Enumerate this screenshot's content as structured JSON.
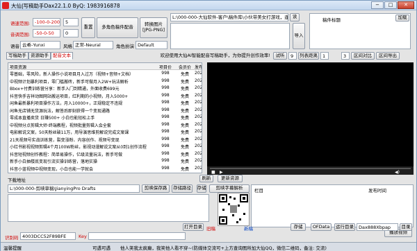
{
  "window": {
    "title": "大仙|写稿助手Dax22.1.0 ByQ: 1983916878",
    "min": "−",
    "max": "□",
    "close": "✕"
  },
  "top": {
    "speed_label": "语速范围:",
    "speed_range": "-100-0-200",
    "speed_value": "5",
    "volume_label": "音调范围:",
    "volume_range": "-50-0-50",
    "volume_value": "0",
    "reset_btn": "重置",
    "multi_role_btn": "多角色稿件配音",
    "convert_btn": "转换图片 [JPG-PNG]",
    "voice_label": "语音",
    "voice_value": "云希-Yunxi",
    "style_label": "风格",
    "style_value": "正常-Neural",
    "role_label": "角色扮演",
    "role_value": "Default",
    "path_value": "L:\\000-000-大仙软件-客户\\稿件库\\小伙带美女打游戏，逢料",
    "read_btn": "读",
    "import_btn": "导入",
    "script_title_label": "稿件标题",
    "load_btn": "加载"
  },
  "tabs": {
    "writing": "写稿助手",
    "resources": "资源助手",
    "dubbing": "配音文本"
  },
  "welcome": "欢迎使用大仙AI智能配音写稿助手，为你提升创作效率!",
  "player": {
    "listen_btn": "试听",
    "count1": "9",
    "dist_btn": "列表距离",
    "count2": "1",
    "check_btn": "区间对比",
    "num": "3",
    "section_btn": "区间对比",
    "export_btn": "区间导出"
  },
  "grid": {
    "headers": [
      "项目资源",
      "项目价",
      "会员价",
      "发布时间"
    ],
    "rows": [
      [
        "零基础，零风险，新人操作小说项目月入过万（视频+音频+文档）",
        "998",
        "免费",
        "2022-06-11"
      ],
      [
        "中视频计划暴利项目，零门槛搬砖，新手可做月入2W+玩法解析",
        "998",
        "免费",
        "2022-06-11"
      ],
      [
        "Bbox+付费训练营分享：新手入门到精通，外面收费699元",
        "998",
        "免费",
        "2022-06-11"
      ],
      [
        "抖音快手吉祥动图网站搬运项目，红利期的小视频，月入5000+",
        "998",
        "免费",
        "2022-06-11"
      ],
      [
        "闲鱼最新暴利项目操作方法，月入10000+，正规稳定不违规",
        "998",
        "免费",
        "2022-06-11"
      ],
      [
        "闲鱼无店铺无货源玩法，解答后即刻获得一个变现通路",
        "998",
        "免费",
        "2022-06-11"
      ],
      [
        "零成本直播卖货 日赚500+ 小白也能轻松上手",
        "998",
        "免费",
        "2022-06-11"
      ],
      [
        "中视频分点剪辑大师·终端教程，视频批量剪辑入会全套",
        "998",
        "免费",
        "2022-06-11"
      ],
      [
        "电影解说文案，50天粉丝破11万，用导演思维剪解说完成文案课",
        "998",
        "免费",
        "2022-06-11"
      ],
      [
        "21天视频号实战训练营，裂变涨粉、内容创作、视频号变现",
        "998",
        "免费",
        "2022-06-11"
      ],
      [
        "小红书影视视频剪辑4个月100W粉丝，影视动漫解说文案从0到1创作流程",
        "998",
        "免费",
        "2022-06-11"
      ],
      [
        "抖音短视频创作教程：简单易操作，亿级流量玩法，新手可做",
        "998",
        "免费",
        "2022-06-11"
      ],
      [
        "新手小白抽楼底变现引流实操训练营，落地实操",
        "998",
        "免费",
        "2022-06-11"
      ],
      [
        "抖音小蓝视频中视频变现，小白也能一学就会",
        "998",
        "免费",
        "2022-06-11"
      ]
    ]
  },
  "download": {
    "label": "下载地址",
    "refresh_btn": "刷新",
    "update_btn": "更新资源",
    "path": "L:\\000-000-剪映草稿\\JianyingPro Drafts",
    "save_btn": "剪映保存路",
    "save_path_btn": "存储路径",
    "parse_btn": "剪映字幕解析",
    "save2_btn": "存储",
    "column_label": "栏目",
    "time_label": "发布时间",
    "play_btn": "播放视频"
  },
  "bottom": {
    "open_dir_btn": "打开目录",
    "old_label": "旧稿",
    "new_label": "新稿",
    "store_btn": "存储",
    "data_btn": "OFData",
    "run_btn": "运行目录",
    "run_value": "Dax888Xbpap",
    "dir_btn": "目录",
    "id_label": "识别码",
    "id_value": "4003DCC52F89BFE",
    "key_label": "Key"
  },
  "status": {
    "left": "温馨提醒",
    "mid": "可遇可遇",
    "msg": "他人笑我太疯癫，我笑他人看不穿~(防媒体交流可+上方查询图所加大仙QQ，微信二维码，备注: 交流)"
  }
}
